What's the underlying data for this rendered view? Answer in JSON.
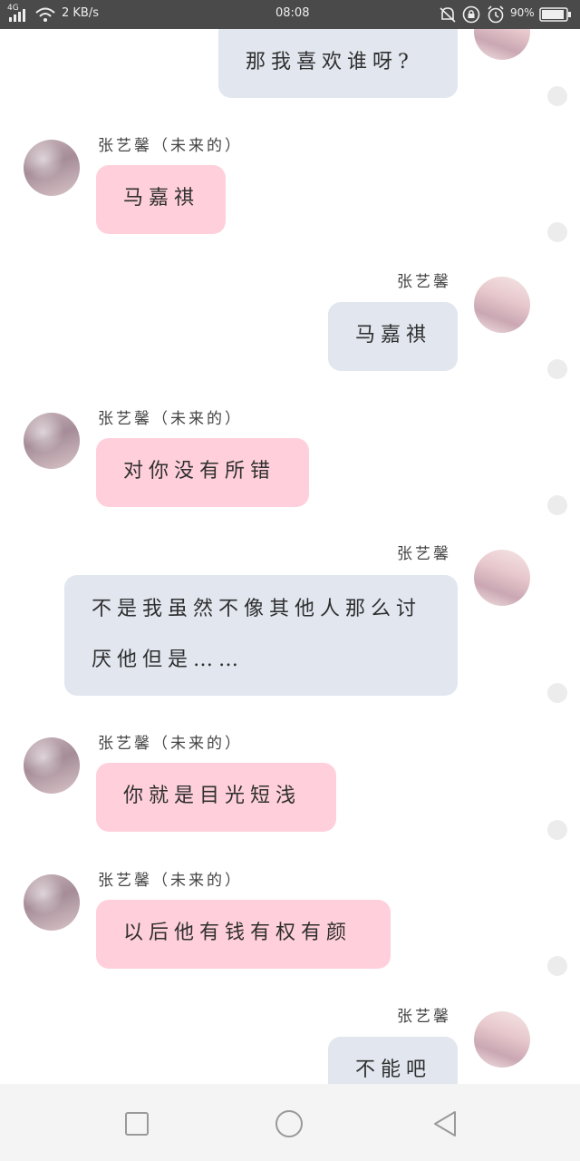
{
  "status_bar": {
    "network": "4G",
    "speed": "2 KB/s",
    "time": "08:08",
    "battery": "90%"
  },
  "contacts": {
    "me": "张艺馨",
    "other": "张艺馨（未来的）"
  },
  "messages": [
    {
      "side": "right",
      "text": "那我喜欢谁呀?"
    },
    {
      "side": "left",
      "text": "马嘉祺"
    },
    {
      "side": "right",
      "text": "马嘉祺"
    },
    {
      "side": "left",
      "text": "对你没有所错"
    },
    {
      "side": "right",
      "text": "不是我虽然不像其他人那么讨厌他但是……"
    },
    {
      "side": "left",
      "text": "你就是目光短浅"
    },
    {
      "side": "left",
      "text": "以后他有钱有权有颜"
    },
    {
      "side": "right",
      "text": "不能吧"
    }
  ],
  "nav_bar": {
    "buttons": [
      "recent-apps",
      "home",
      "back"
    ]
  }
}
